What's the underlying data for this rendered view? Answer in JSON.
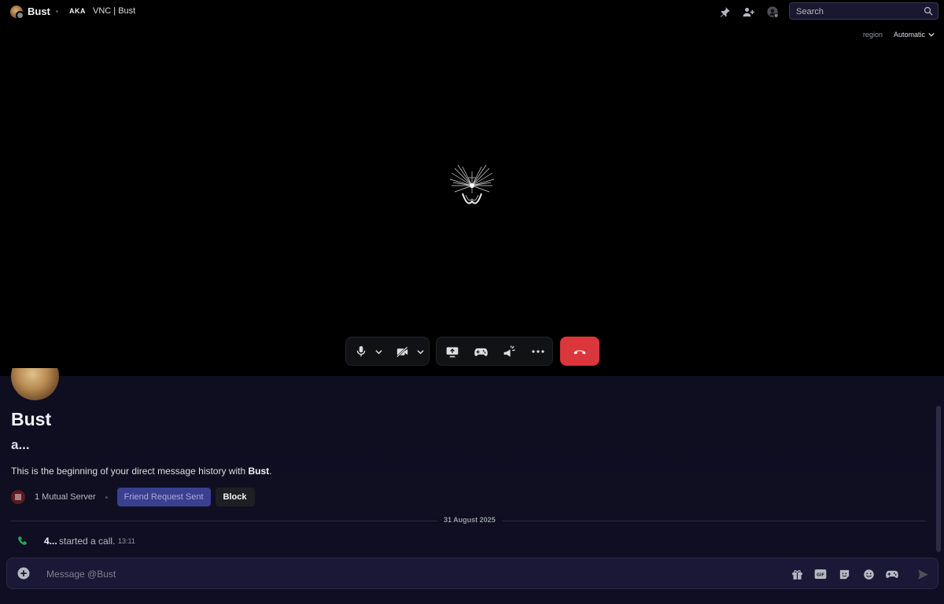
{
  "topbar": {
    "user_name": "Bust",
    "aka_label": "AKA",
    "aka_names": "VNC | Bust",
    "icons": [
      "pin-icon",
      "add-friends-icon",
      "user-profile-icon"
    ],
    "search_placeholder": "Search"
  },
  "call": {
    "region_label": "region",
    "region_value": "Automatic",
    "controls": {
      "mic": "microphone-icon",
      "camera": "camera-off-icon",
      "screen_share": "screen-share-icon",
      "activities": "gamepad-icon",
      "soundboard": "soundboard-icon",
      "more": "more-icon",
      "end_call": "hang-up-icon"
    },
    "end_call_color": "#da373c"
  },
  "profile": {
    "display_name": "Bust",
    "username": "a...",
    "intro_prefix": "This is the beginning of your direct message history with ",
    "intro_name": "Bust",
    "intro_suffix": ".",
    "mutual_servers": "1 Mutual Server",
    "friend_request_label": "Friend Request Sent",
    "block_label": "Block"
  },
  "messages": {
    "date_divider": "31 August 2025",
    "items": [
      {
        "author": "4...",
        "action": "started a call.",
        "time": "13:11",
        "icon": "phone-icon"
      }
    ]
  },
  "composer": {
    "placeholder": "Message @Bust",
    "icons": [
      "gift-icon",
      "gif-icon",
      "sticker-icon",
      "emoji-icon",
      "apps-icon",
      "send-icon"
    ]
  }
}
